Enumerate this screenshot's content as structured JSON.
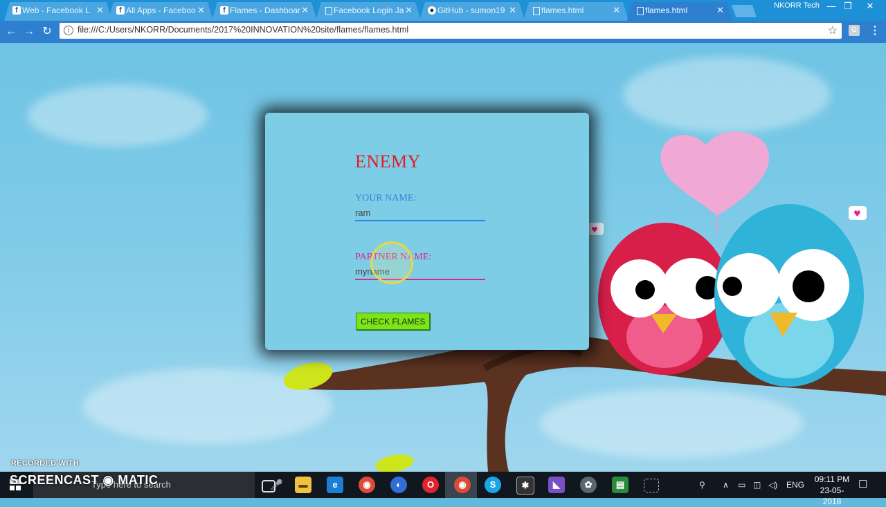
{
  "browser": {
    "tabs": [
      {
        "title": "Web - Facebook L",
        "icon": "facebook-icon"
      },
      {
        "title": "All Apps - Faceboo",
        "icon": "facebook-icon"
      },
      {
        "title": "Flames - Dashboar",
        "icon": "facebook-icon"
      },
      {
        "title": "Facebook Login Ja",
        "icon": "document-icon"
      },
      {
        "title": "GitHub - sumon19",
        "icon": "github-icon"
      },
      {
        "title": "flames.html",
        "icon": "document-icon"
      },
      {
        "title": "flames.html",
        "icon": "document-icon",
        "active": true
      }
    ],
    "window_label": "NKORR Tech",
    "url": "file:///C:/Users/NKORR/Documents/2017%20INNOVATION%20site/flames/flames.html"
  },
  "app": {
    "result": "ENEMY",
    "your_name_label": "YOUR NAME:",
    "your_name_value": "ram",
    "partner_name_label": "PARTNER NAME:",
    "partner_name_value": "myname",
    "check_button": "CHECK FLAMES",
    "colors": {
      "result": "#e31b23",
      "your_label": "#3a7ee0",
      "partner_label": "#e0248c",
      "button": "#7fe31a"
    }
  },
  "taskbar": {
    "search_placeholder": "Type here to search",
    "language": "ENG",
    "time": "09:11 PM",
    "date": "23-05-2018"
  },
  "watermark": {
    "label": "RECORDED WITH",
    "brand": "SCREENCAST",
    "brand_suffix": "MATIC"
  }
}
